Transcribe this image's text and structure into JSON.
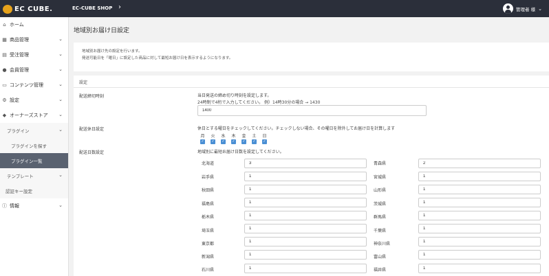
{
  "header": {
    "logo_text": "EC CUBE.",
    "shop_name": "EC-CUBE SHOP",
    "shop_chevron": "›",
    "user_name": "管理者 様",
    "user_caret": "⌄"
  },
  "sidebar": {
    "items": [
      {
        "icon": "⌂",
        "label": "ホーム"
      },
      {
        "icon": "▦",
        "label": "商品管理",
        "chev": "⌄"
      },
      {
        "icon": "▤",
        "label": "受注管理",
        "chev": "⌄"
      },
      {
        "icon": "●",
        "label": "会員管理",
        "chev": "⌄"
      },
      {
        "icon": "▭",
        "label": "コンテンツ管理",
        "chev": "⌄"
      },
      {
        "icon": "⚙",
        "label": "設定",
        "chev": "⌄"
      },
      {
        "icon": "◆",
        "label": "オーナーズストア",
        "chev": "⌄"
      }
    ],
    "plugin": {
      "label": "プラグイン",
      "chev": "⌄"
    },
    "plugin_search": "プラグインを探す",
    "plugin_list": "プラグイン一覧",
    "template": {
      "label": "テンプレート",
      "chev": "⌄"
    },
    "auth_key": "認証キー設定",
    "info": {
      "icon": "ⓘ",
      "label": "情報",
      "chev": "⌄"
    }
  },
  "page": {
    "title": "地域別お届け日設定"
  },
  "notice": {
    "line1": "地域別お届け先の設定を行います。",
    "line2": "発送可能日を「曜日」に設定した商品に対して最短お届け日を表示するようになります。"
  },
  "card": {
    "title": "設定",
    "cutoff_label": "配送締切時刻",
    "cutoff_help1": "当日発送の締め切り時刻を設定します。",
    "cutoff_help2": "24時制で4桁で入力してください。 例）14時30分の場合 → 1430",
    "cutoff_value": "1400",
    "holiday_label": "配送休日設定",
    "holiday_help": "休日とする曜日をチェックしてください。チェックしない場合、その曜日を除外してお届け日を計算します",
    "days": [
      "月",
      "火",
      "水",
      "木",
      "金",
      "土",
      "日"
    ],
    "check_mark": "✓",
    "lead_label": "配送日数設定",
    "lead_help": "地域別に最短お届け日数を設定してください。"
  },
  "prefectures_left": [
    {
      "name": "北海道",
      "value": "3"
    },
    {
      "name": "岩手県",
      "value": "1"
    },
    {
      "name": "秋田県",
      "value": "1"
    },
    {
      "name": "福島県",
      "value": "1"
    },
    {
      "name": "栃木県",
      "value": "1"
    },
    {
      "name": "埼玉県",
      "value": "1"
    },
    {
      "name": "東京都",
      "value": "1"
    },
    {
      "name": "新潟県",
      "value": "1"
    },
    {
      "name": "石川県",
      "value": "1"
    }
  ],
  "prefectures_right": [
    {
      "name": "青森県",
      "value": "2"
    },
    {
      "name": "宮城県",
      "value": "1"
    },
    {
      "name": "山形県",
      "value": "1"
    },
    {
      "name": "茨城県",
      "value": "1"
    },
    {
      "name": "群馬県",
      "value": "1"
    },
    {
      "name": "千葉県",
      "value": "1"
    },
    {
      "name": "神奈川県",
      "value": "1"
    },
    {
      "name": "富山県",
      "value": "1"
    },
    {
      "name": "福井県",
      "value": "1"
    }
  ]
}
